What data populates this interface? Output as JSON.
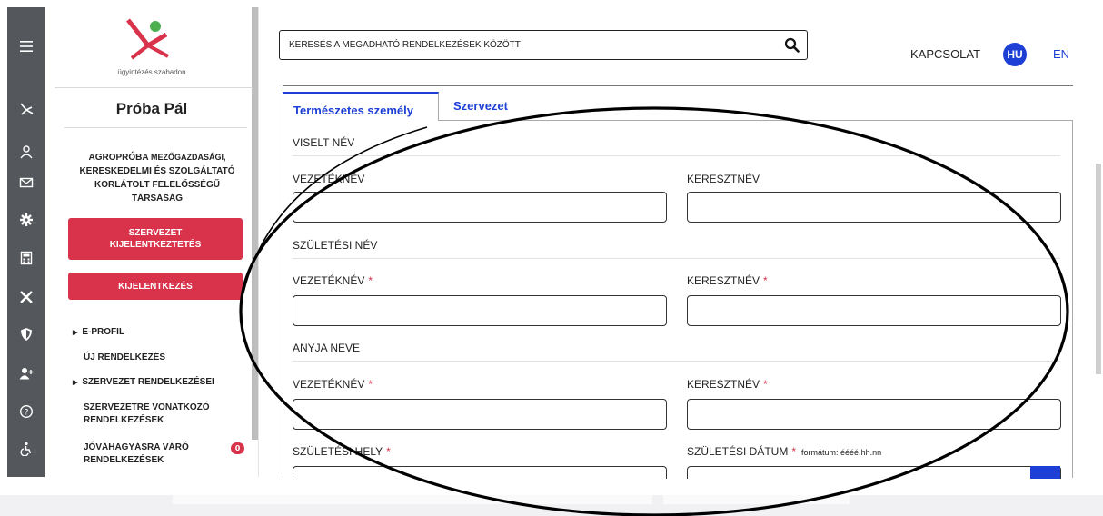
{
  "logo": {
    "tagline": "ügyintézés szabadon"
  },
  "sidebar": {
    "user_name": "Próba Pál",
    "org_name_line1": "AGROPRÓBA",
    "org_name_line1b": "MEZŐGAZDASÁGI,",
    "org_name_line2": "KERESKEDELMI ÉS SZOLGÁLTATÓ",
    "org_name_line3": "KORLÁTOLT FELELŐSSÉGŰ",
    "org_name_line4": "TÁRSASÁG",
    "org_logout_line1": "SZERVEZET",
    "org_logout_line2": "KIJELENTKEZTETÉS",
    "logout": "KIJELENTKEZÉS",
    "nav": {
      "eprofil": "E-PROFIL",
      "uj_rendelkezes": "ÚJ RENDELKEZÉS",
      "szervezet_rendelkezesei": "SZERVEZET RENDELKEZÉSEI",
      "vonatkozo_line1": "SZERVEZETRE VONATKOZÓ",
      "vonatkozo_line2": "RENDELKEZÉSEK",
      "jovahagyasra_line1": "JÓVÁHAGYÁSRA VÁRÓ",
      "jovahagyasra_line2": "RENDELKEZÉSEK",
      "jovahagyasra_count": "0"
    }
  },
  "header": {
    "search_placeholder": "KERESÉS A MEGADHATÓ RENDELKEZÉSEK KÖZÖTT",
    "contact": "KAPCSOLAT",
    "lang_hu": "HU",
    "lang_en": "EN"
  },
  "tabs": {
    "natural_person": "Természetes személy",
    "organization": "Szervezet"
  },
  "form": {
    "viselt_nev": "VISELT NÉV",
    "szuletesi_nev": "SZÜLETÉSI NÉV",
    "anyja_neve": "ANYJA NEVE",
    "vezeteknev": "VEZETÉKNÉV",
    "keresztnev": "KERESZTNÉV",
    "szuletesi_hely": "SZÜLETÉSI HELY",
    "szuletesi_datum": "SZÜLETÉSI DÁTUM",
    "date_format_hint": "formátum: éééé.hh.nn",
    "required_mark": "*"
  },
  "colors": {
    "brand_red": "#d8334a",
    "brand_blue": "#1e3fd6",
    "rail": "#54575c"
  },
  "icons": [
    "menu-icon",
    "brand-icon",
    "user-icon",
    "mail-icon",
    "gear-icon",
    "calculator-icon",
    "tools-icon",
    "shield-icon",
    "add-user-icon",
    "help-icon",
    "accessibility-icon",
    "search-icon",
    "calendar-icon"
  ]
}
